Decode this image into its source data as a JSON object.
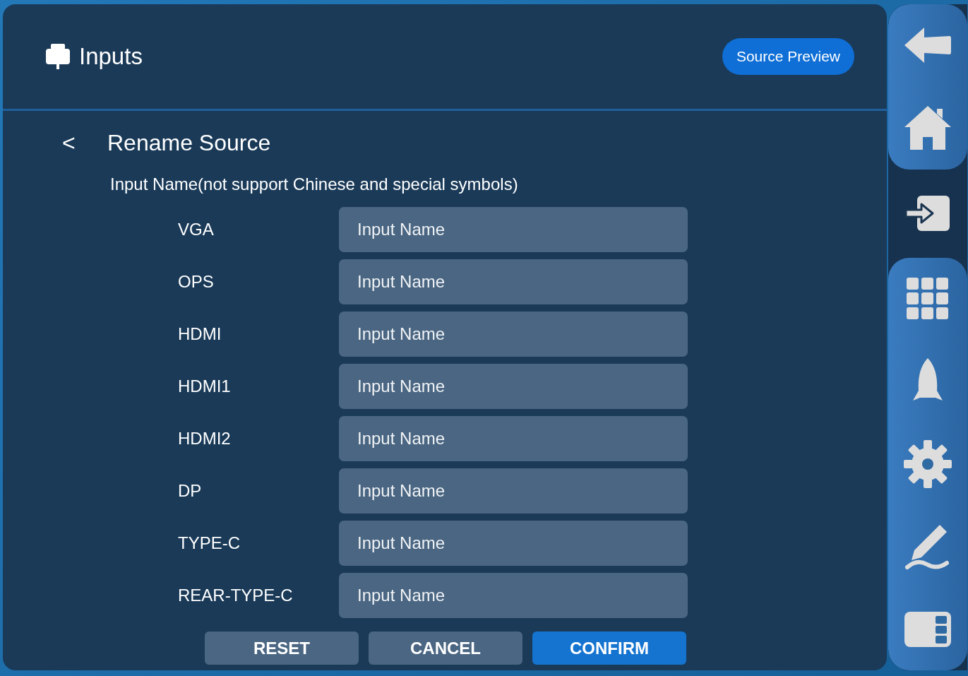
{
  "header": {
    "title": "Inputs",
    "preview_button": "Source Preview"
  },
  "page": {
    "back": "<",
    "title": "Rename Source",
    "hint": "Input Name(not support Chinese and special symbols)"
  },
  "sources": [
    {
      "label": "VGA",
      "placeholder": "Input Name"
    },
    {
      "label": "OPS",
      "placeholder": "Input Name"
    },
    {
      "label": "HDMI",
      "placeholder": "Input Name"
    },
    {
      "label": "HDMI1",
      "placeholder": "Input Name"
    },
    {
      "label": "HDMI2",
      "placeholder": "Input Name"
    },
    {
      "label": "DP",
      "placeholder": "Input Name"
    },
    {
      "label": "TYPE-C",
      "placeholder": "Input Name"
    },
    {
      "label": "REAR-TYPE-C",
      "placeholder": "Input Name"
    }
  ],
  "buttons": [
    {
      "label": "RESET",
      "primary": false
    },
    {
      "label": "CANCEL",
      "primary": false
    },
    {
      "label": "CONFIRM",
      "primary": true
    }
  ],
  "sidebar": [
    {
      "kind": "back",
      "selected": false
    },
    {
      "kind": "home",
      "selected": false
    },
    {
      "kind": "input",
      "selected": true
    },
    {
      "kind": "apps",
      "selected": false
    },
    {
      "kind": "rocket",
      "selected": false
    },
    {
      "kind": "settings",
      "selected": false
    },
    {
      "kind": "pen",
      "selected": false
    },
    {
      "kind": "panel",
      "selected": false
    }
  ]
}
